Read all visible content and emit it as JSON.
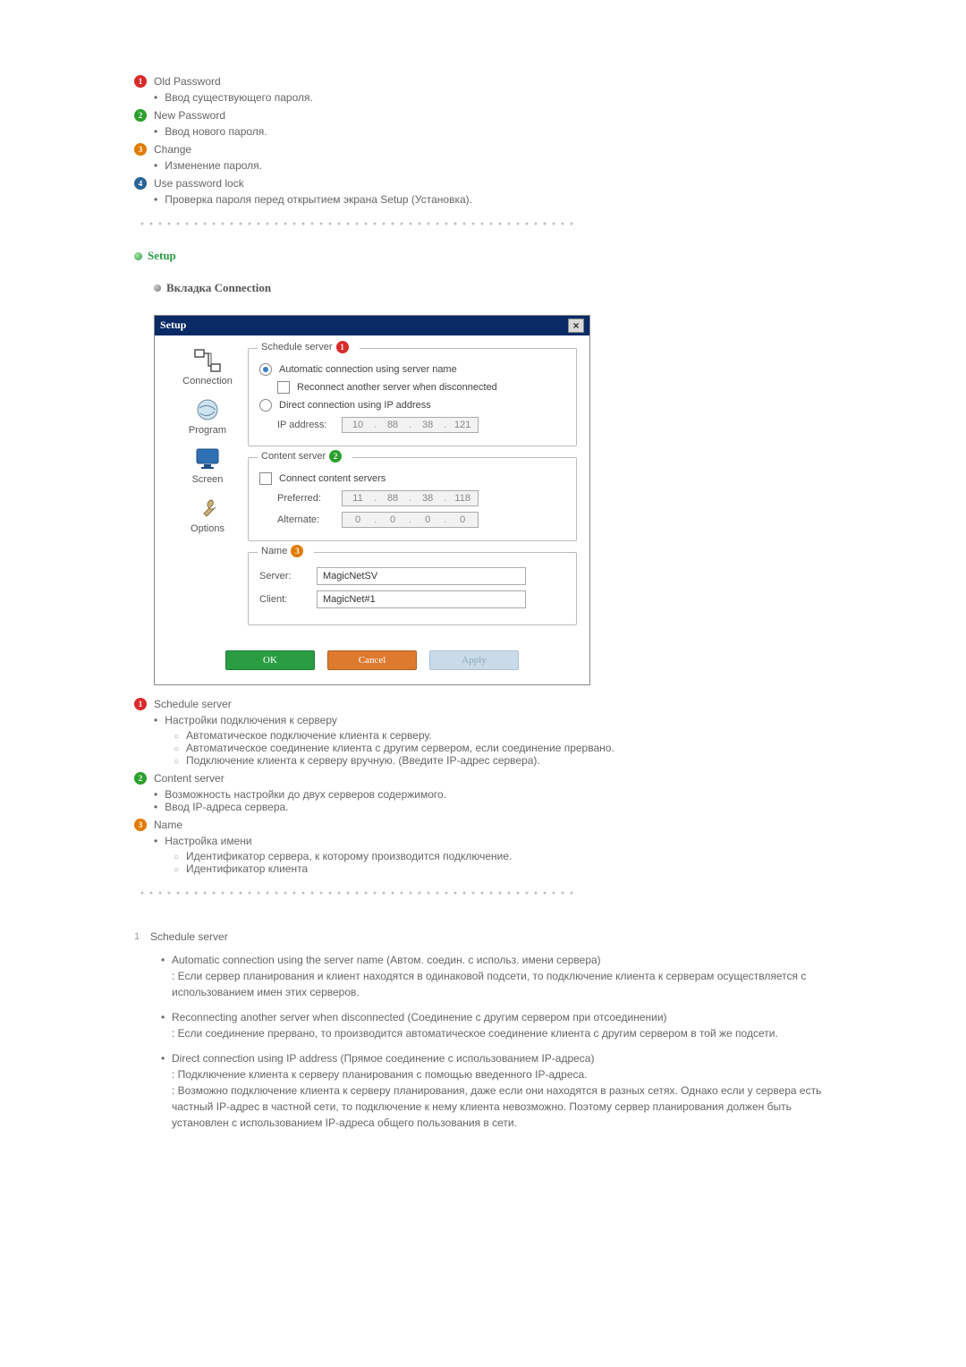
{
  "numlist": [
    {
      "num": "1",
      "badgeClass": "bg-red",
      "label": "Old Password",
      "bullets": [
        "Ввод существующего пароля."
      ]
    },
    {
      "num": "2",
      "badgeClass": "bg-green",
      "label": "New Password",
      "bullets": [
        "Ввод нового пароля."
      ]
    },
    {
      "num": "3",
      "badgeClass": "bg-orange",
      "label": "Change",
      "bullets": [
        "Изменение пароля."
      ]
    },
    {
      "num": "4",
      "badgeClass": "bg-blue",
      "label": "Use password lock",
      "bullets": [
        "Проверка пароля перед открытием экрана Setup (Установка)."
      ]
    }
  ],
  "setup": {
    "heading": "Setup",
    "tab": "Вкладка Connection"
  },
  "dialog": {
    "title": "Setup",
    "close": "×",
    "tabs": [
      "Connection",
      "Program",
      "Screen",
      "Options"
    ],
    "schedule": {
      "legend": "Schedule server",
      "badge": "1",
      "radio1": "Automatic connection using server name",
      "chk": "Reconnect another server when disconnected",
      "radio2": "Direct connection using IP address",
      "ipLabel": "IP address:",
      "ip": [
        "10",
        "88",
        "38",
        "121"
      ]
    },
    "content": {
      "legend": "Content server",
      "badge": "2",
      "chk": "Connect content servers",
      "prefLabel": "Preferred:",
      "pref": [
        "11",
        "88",
        "38",
        "118"
      ],
      "altLabel": "Alternate:",
      "alt": [
        "0",
        "0",
        "0",
        "0"
      ]
    },
    "name": {
      "legend": "Name",
      "badge": "3",
      "serverLabel": "Server:",
      "server": "MagicNetSV",
      "clientLabel": "Client:",
      "client": "MagicNet#1"
    },
    "buttons": {
      "ok": "OK",
      "cancel": "Cancel",
      "apply": "Apply"
    }
  },
  "setupNumlist": [
    {
      "num": "1",
      "badgeClass": "bg-red",
      "label": "Schedule server",
      "bullets": [
        {
          "text": "Настройки подключения к серверу",
          "sub": [
            "Автоматическое подключение клиента к серверу.",
            "Автоматическое соединение клиента с другим сервером, если соединение прервано.",
            "Подключение клиента к серверу вручную. (Введите IP-адрес сервера)."
          ]
        }
      ]
    },
    {
      "num": "2",
      "badgeClass": "bg-green",
      "label": "Content server",
      "bullets": [
        {
          "text": "Возможность настройки до двух серверов содержимого."
        },
        {
          "text": "Ввод IP-адреса сервера."
        }
      ]
    },
    {
      "num": "3",
      "badgeClass": "bg-orange",
      "label": "Name",
      "bullets": [
        {
          "text": "Настройка имени",
          "sub": [
            "Идентификатор сервера, к которому производится подключение.",
            "Идентификатор клиента"
          ]
        }
      ]
    }
  ],
  "ordered": {
    "num": "1",
    "title": "Schedule server",
    "details": [
      "Automatic connection using the server name (Автом. соедин. с использ. имени сервера)\n: Если сервер планирования и клиент находятся в одинаковой подсети, то подключение клиента к серверам осуществляется с использованием имен этих серверов.",
      "Reconnecting another server when disconnected (Соединение с другим сервером при отсоединении)\n: Если соединение прервано, то производится автоматическое соединение клиента с другим сервером в той же подсети.",
      "Direct connection using IP address (Прямое соединение с использованием IP-адреса)\n: Подключение клиента к серверу планирования с помощью введенного IP-адреса.\n: Возможно подключение клиента к серверу планирования, даже если они находятся в разных сетях. Однако если у сервера есть частный IP-адрес в частной сети, то подключение к нему клиента невозможно. Поэтому сервер планирования должен быть установлен с использованием IP-адреса общего пользования в сети."
    ]
  }
}
